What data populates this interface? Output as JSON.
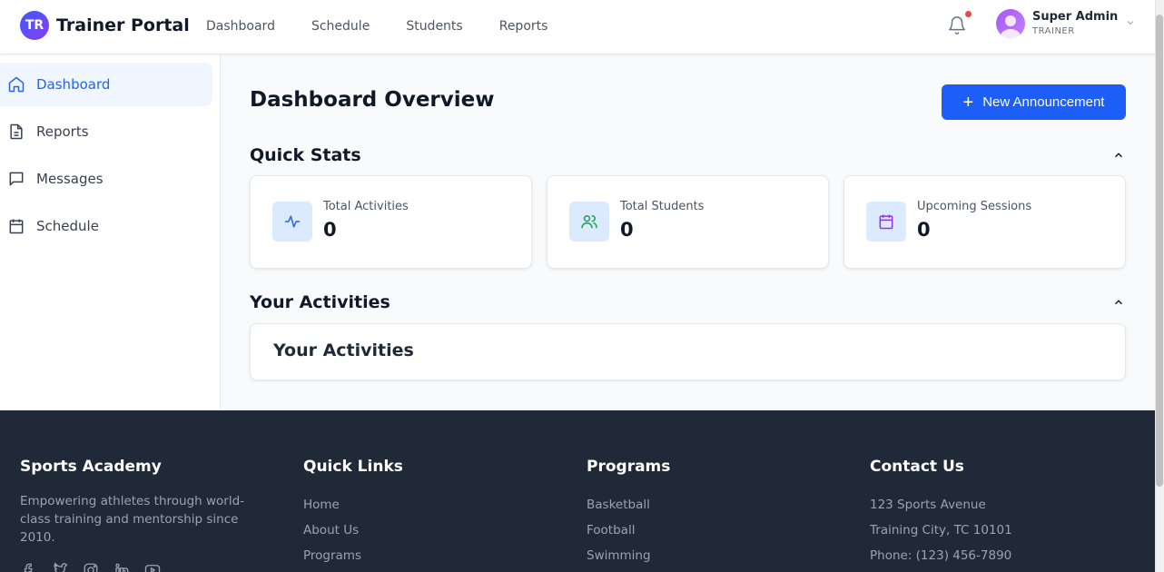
{
  "header": {
    "logo_initials": "TR",
    "brand": "Trainer Portal",
    "nav": [
      "Dashboard",
      "Schedule",
      "Students",
      "Reports"
    ],
    "user": {
      "name": "Super Admin",
      "role": "TRAINER"
    }
  },
  "sidebar": {
    "items": [
      {
        "label": "Dashboard",
        "icon": "home-icon",
        "active": true
      },
      {
        "label": "Reports",
        "icon": "document-icon"
      },
      {
        "label": "Messages",
        "icon": "chat-icon"
      },
      {
        "label": "Schedule",
        "icon": "calendar-icon"
      }
    ]
  },
  "main": {
    "title": "Dashboard Overview",
    "new_button": "New Announcement",
    "quick_stats_title": "Quick Stats",
    "stats": [
      {
        "label": "Total Activities",
        "value": "0",
        "icon": "activity-icon",
        "color": "#2563eb"
      },
      {
        "label": "Total Students",
        "value": "0",
        "icon": "users-icon",
        "color": "#16a34a"
      },
      {
        "label": "Upcoming Sessions",
        "value": "0",
        "icon": "calendar-icon",
        "color": "#9333ea"
      }
    ],
    "activities_section_title": "Your Activities",
    "activities_card_title": "Your Activities"
  },
  "footer": {
    "about": {
      "title": "Sports Academy",
      "description": "Empowering athletes through world-class training and mentorship since 2010.",
      "social": [
        "facebook-icon",
        "twitter-icon",
        "instagram-icon",
        "linkedin-icon",
        "youtube-icon"
      ]
    },
    "quick_links": {
      "title": "Quick Links",
      "links": [
        "Home",
        "About Us",
        "Programs"
      ]
    },
    "programs": {
      "title": "Programs",
      "links": [
        "Basketball",
        "Football",
        "Swimming"
      ]
    },
    "contact": {
      "title": "Contact Us",
      "lines": [
        "123 Sports Avenue",
        "Training City, TC 10101",
        "Phone: (123) 456-7890"
      ]
    }
  },
  "colors": {
    "primary": "#1d5ef6",
    "footer_bg": "#1f2937",
    "notification": "#ef4444"
  }
}
